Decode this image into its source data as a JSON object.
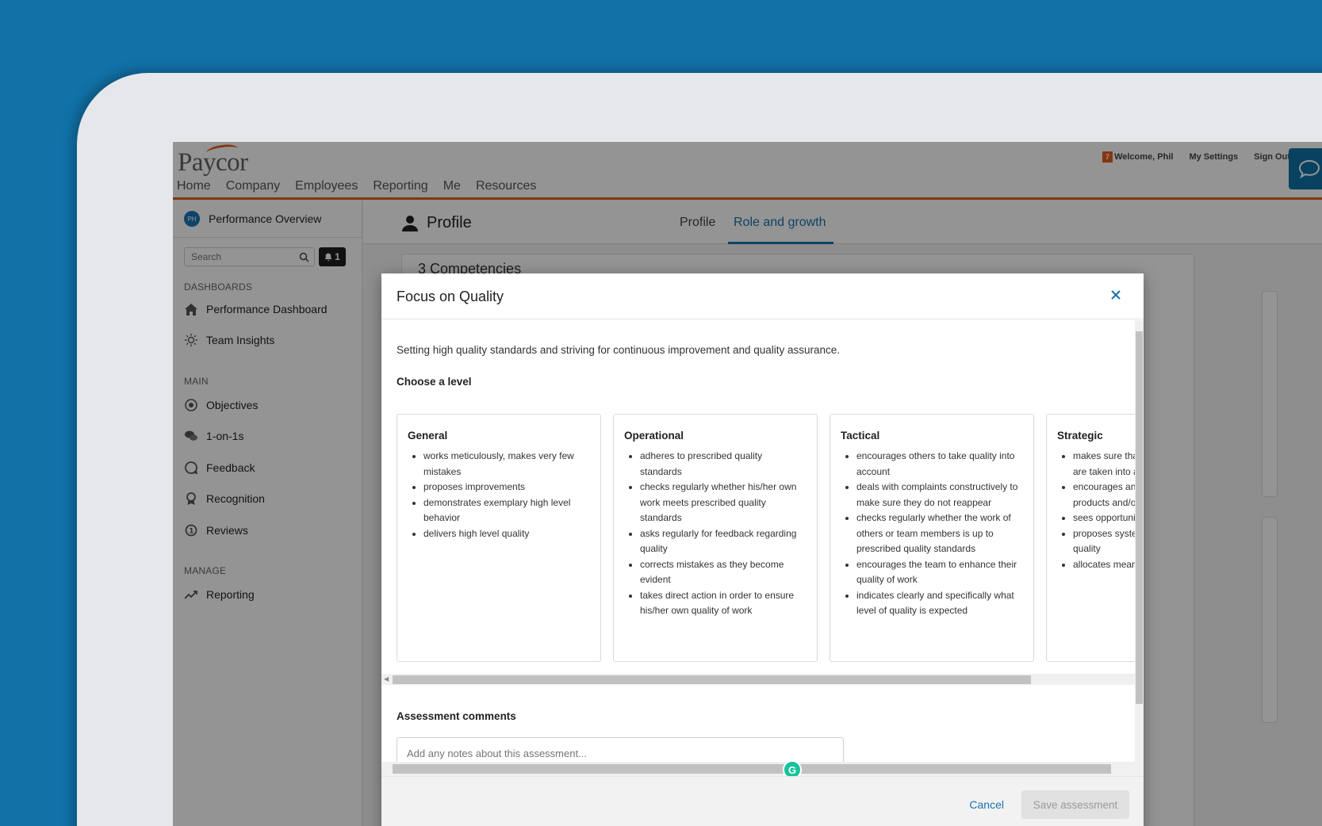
{
  "app": {
    "logo": "Paycor",
    "topnav": [
      "Home",
      "Company",
      "Employees",
      "Reporting",
      "Me",
      "Resources"
    ],
    "notification_count": "7",
    "welcome": "Welcome, Phil",
    "my_settings": "My Settings",
    "sign_out": "Sign Out",
    "accent": "#e35d1f",
    "brand_blue": "#1172a8"
  },
  "sidebar": {
    "avatar_initials": "PH",
    "title": "Performance Overview",
    "search_placeholder": "Search",
    "notif_count": "1",
    "sections": {
      "dashboards": "DASHBOARDS",
      "main": "MAIN",
      "manage": "MANAGE"
    },
    "items": [
      {
        "label": "Performance Dashboard",
        "icon": "home-icon"
      },
      {
        "label": "Team Insights",
        "icon": "lightbulb-icon"
      },
      {
        "label": "Objectives",
        "icon": "target-icon"
      },
      {
        "label": "1-on-1s",
        "icon": "chat-bubbles-icon"
      },
      {
        "label": "Feedback",
        "icon": "feedback-icon"
      },
      {
        "label": "Recognition",
        "icon": "award-icon"
      },
      {
        "label": "Reviews",
        "icon": "reviews-icon"
      },
      {
        "label": "Reporting",
        "icon": "trend-icon"
      }
    ]
  },
  "main": {
    "profile_title": "Profile",
    "tabs": [
      {
        "label": "Profile",
        "active": false
      },
      {
        "label": "Role and growth",
        "active": true
      }
    ],
    "competencies_heading": "3 Competencies"
  },
  "modal": {
    "title": "Focus on Quality",
    "description": "Setting high quality standards and striving for continuous improvement and quality assurance.",
    "choose_level": "Choose a level",
    "levels": [
      {
        "name": "General",
        "bullets": [
          "works meticulously, makes very few mistakes",
          "proposes improvements",
          "demonstrates exemplary high level behavior",
          "delivers high level quality"
        ]
      },
      {
        "name": "Operational",
        "bullets": [
          "adheres to prescribed quality standards",
          "checks regularly whether his/her own work meets prescribed quality standards",
          "asks regularly for feedback regarding quality",
          "corrects mistakes as they become evident",
          "takes direct action in order to ensure his/her own quality of work"
        ]
      },
      {
        "name": "Tactical",
        "bullets": [
          "encourages others to take quality into account",
          "deals with complaints constructively to make sure they do not reappear",
          "checks regularly whether the work of others or team members is up to prescribed quality standards",
          "encourages the team to enhance their quality of work",
          "indicates clearly and specifically what level of quality is expected"
        ]
      },
      {
        "name": "Strategic",
        "bullets": [
          "makes sure that quality standards are taken into account in all r",
          "encourages an enhance the qu products and/o",
          "sees opportuni",
          "proposes syste focused on enh quality",
          "allocates mean organization to"
        ]
      }
    ],
    "assessment_label": "Assessment comments",
    "notes_placeholder": "Add any notes about this assessment...",
    "cancel_label": "Cancel",
    "save_label": "Save assessment",
    "grammarly_letter": "G"
  }
}
